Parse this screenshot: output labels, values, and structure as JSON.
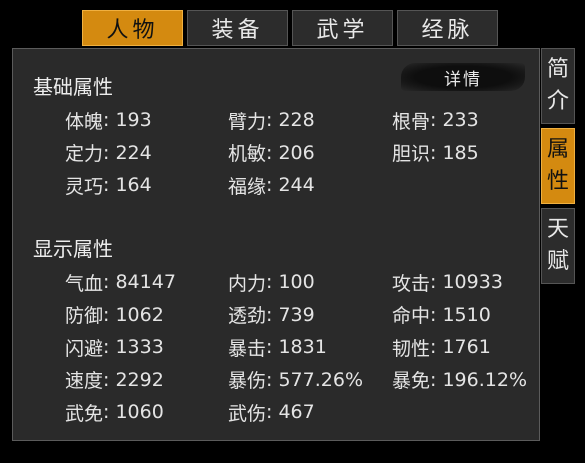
{
  "top_tabs": [
    {
      "label": "人物",
      "active": true
    },
    {
      "label": "装备",
      "active": false
    },
    {
      "label": "武学",
      "active": false
    },
    {
      "label": "经脉",
      "active": false
    }
  ],
  "side_tabs": [
    {
      "chars": [
        "简",
        "介"
      ],
      "active": false
    },
    {
      "chars": [
        "属",
        "性"
      ],
      "active": true
    },
    {
      "chars": [
        "天",
        "赋"
      ],
      "active": false
    }
  ],
  "basic": {
    "title": "基础属性",
    "detail_label": "详情",
    "stats": [
      {
        "label": "体魄",
        "value": "193"
      },
      {
        "label": "臂力",
        "value": "228"
      },
      {
        "label": "根骨",
        "value": "233"
      },
      {
        "label": "定力",
        "value": "224"
      },
      {
        "label": "机敏",
        "value": "206"
      },
      {
        "label": "胆识",
        "value": "185"
      },
      {
        "label": "灵巧",
        "value": "164"
      },
      {
        "label": "福缘",
        "value": "244"
      }
    ]
  },
  "display": {
    "title": "显示属性",
    "stats": [
      {
        "label": "气血",
        "value": "84147"
      },
      {
        "label": "内力",
        "value": "100"
      },
      {
        "label": "攻击",
        "value": "10933"
      },
      {
        "label": "防御",
        "value": "1062"
      },
      {
        "label": "透劲",
        "value": "739"
      },
      {
        "label": "命中",
        "value": "1510"
      },
      {
        "label": "闪避",
        "value": "1333"
      },
      {
        "label": "暴击",
        "value": "1831"
      },
      {
        "label": "韧性",
        "value": "1761"
      },
      {
        "label": "速度",
        "value": "2292"
      },
      {
        "label": "暴伤",
        "value": "577.26%"
      },
      {
        "label": "暴免",
        "value": "196.12%"
      },
      {
        "label": "武免",
        "value": "1060"
      },
      {
        "label": "武伤",
        "value": "467"
      }
    ]
  }
}
